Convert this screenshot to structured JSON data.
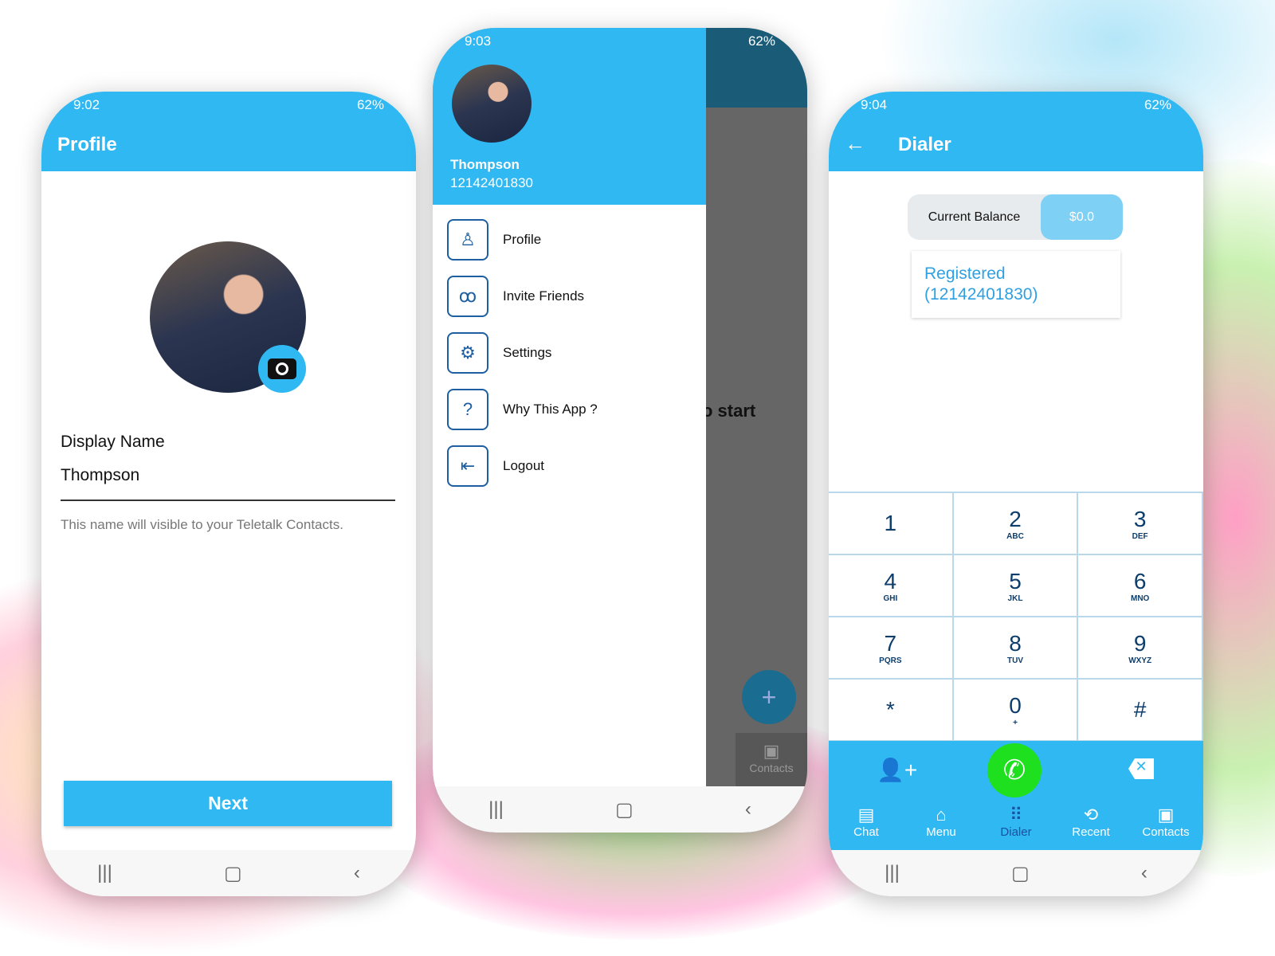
{
  "status": [
    {
      "time": "9:02",
      "battery": "62%"
    },
    {
      "time": "9:03",
      "battery": "62%"
    },
    {
      "time": "9:04",
      "battery": "62%"
    }
  ],
  "profile": {
    "title": "Profile",
    "display_name_label": "Display Name",
    "display_name_value": "Thompson",
    "hint": "This name will visible to your Teletalk Contacts.",
    "next_label": "Next"
  },
  "drawer": {
    "name": "Thompson",
    "number": "12142401830",
    "items": [
      {
        "label": "Profile",
        "icon": "person-icon"
      },
      {
        "label": "Invite Friends",
        "icon": "group-icon"
      },
      {
        "label": "Settings",
        "icon": "gear-icon"
      },
      {
        "label": "Why This App ?",
        "icon": "question-icon"
      },
      {
        "label": "Logout",
        "icon": "logout-icon"
      }
    ],
    "behind_text": "o start",
    "behind_tab": "Contacts",
    "fab": "+"
  },
  "dialer": {
    "title": "Dialer",
    "balance_label": "Current Balance",
    "balance_value": "$0.0",
    "registered": "Registered",
    "registered_number": "(12142401830)",
    "keys": [
      {
        "d": "1",
        "l": ""
      },
      {
        "d": "2",
        "l": "ABC"
      },
      {
        "d": "3",
        "l": "DEF"
      },
      {
        "d": "4",
        "l": "GHI"
      },
      {
        "d": "5",
        "l": "JKL"
      },
      {
        "d": "6",
        "l": "MNO"
      },
      {
        "d": "7",
        "l": "PQRS"
      },
      {
        "d": "8",
        "l": "TUV"
      },
      {
        "d": "9",
        "l": "WXYZ"
      },
      {
        "d": "*",
        "l": ""
      },
      {
        "d": "0",
        "l": "+"
      },
      {
        "d": "#",
        "l": ""
      }
    ],
    "tabs": [
      "Chat",
      "Menu",
      "Dialer",
      "Recent",
      "Contacts"
    ]
  },
  "colors": {
    "primary": "#2fb8f2",
    "call": "#1ee01e",
    "active_tab": "#1d4fa0"
  }
}
